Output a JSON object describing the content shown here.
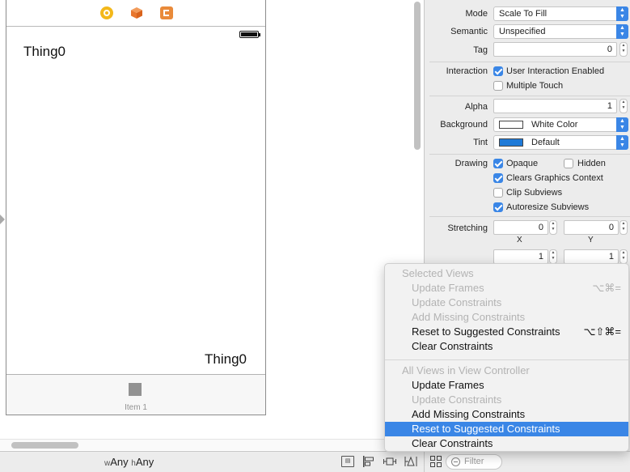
{
  "scene": {
    "top_label": "Thing0",
    "bottom_label": "Thing0",
    "tab_item_label": "Item 1"
  },
  "bottom_bar": {
    "width_prefix": "w",
    "width_value": "Any",
    "height_prefix": "h",
    "height_value": "Any",
    "filter_placeholder": "Filter"
  },
  "inspector": {
    "mode": {
      "label": "Mode",
      "value": "Scale To Fill"
    },
    "semantic": {
      "label": "Semantic",
      "value": "Unspecified"
    },
    "tag": {
      "label": "Tag",
      "value": "0"
    },
    "interaction": {
      "label": "Interaction",
      "options": [
        {
          "label": "User Interaction Enabled",
          "checked": true
        },
        {
          "label": "Multiple Touch",
          "checked": false
        }
      ]
    },
    "alpha": {
      "label": "Alpha",
      "value": "1"
    },
    "background": {
      "label": "Background",
      "value": "White Color",
      "swatch": "#ffffff"
    },
    "tint": {
      "label": "Tint",
      "value": "Default",
      "swatch": "#1e7ad8"
    },
    "drawing": {
      "label": "Drawing",
      "options": [
        {
          "label": "Opaque",
          "checked": true
        },
        {
          "label": "Hidden",
          "checked": false
        },
        {
          "label": "Clears Graphics Context",
          "checked": true
        },
        {
          "label": "Clip Subviews",
          "checked": false
        },
        {
          "label": "Autoresize Subviews",
          "checked": true
        }
      ]
    },
    "stretching": {
      "label": "Stretching",
      "x_value": "0",
      "y_value": "0",
      "x_label": "X",
      "y_label": "Y",
      "width_value": "1",
      "height_value": "1"
    }
  },
  "menu": {
    "section1_header": "Selected Views",
    "section1_items": [
      {
        "label": "Update Frames",
        "shortcut": "⌥⌘=",
        "state": "disabled"
      },
      {
        "label": "Update Constraints",
        "shortcut": "",
        "state": "disabled"
      },
      {
        "label": "Add Missing Constraints",
        "shortcut": "",
        "state": "disabled"
      },
      {
        "label": "Reset to Suggested Constraints",
        "shortcut": "⌥⇧⌘=",
        "state": "enabled"
      },
      {
        "label": "Clear Constraints",
        "shortcut": "",
        "state": "enabled"
      }
    ],
    "section2_header": "All Views in View Controller",
    "section2_items": [
      {
        "label": "Update Frames",
        "shortcut": "",
        "state": "enabled"
      },
      {
        "label": "Update Constraints",
        "shortcut": "",
        "state": "disabled"
      },
      {
        "label": "Add Missing Constraints",
        "shortcut": "",
        "state": "enabled"
      },
      {
        "label": "Reset to Suggested Constraints",
        "shortcut": "",
        "state": "selected"
      },
      {
        "label": "Clear Constraints",
        "shortcut": "",
        "state": "enabled"
      }
    ]
  },
  "icons": {
    "dock": [
      "view-controller-icon",
      "first-responder-icon",
      "exit-icon"
    ],
    "toolbar": [
      "embed-in-stack-icon",
      "align-icon",
      "pin-icon",
      "resolve-auto-layout-icon",
      "document-outline-icon"
    ]
  }
}
